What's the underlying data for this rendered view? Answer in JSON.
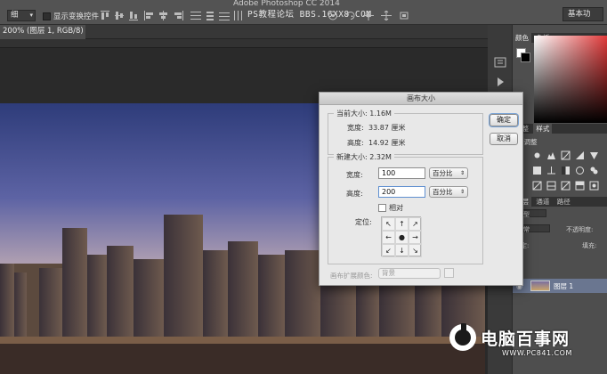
{
  "app": {
    "title": "Adobe Photoshop CC 2014",
    "watermark_text": "PS教程论坛 BBS.16XX8.COM"
  },
  "options_bar": {
    "style_value": "细",
    "show_transform_label": "显示变换控件",
    "workspace_label": "基本功"
  },
  "document": {
    "tab_label": "200% (图层 1, RGB/8) *"
  },
  "panels": {
    "color_tab": "颜色",
    "swatches_tab": "色板",
    "adjust_tab": "样式",
    "adjust_label": "调整",
    "add_adjust_label": "加调整",
    "layers_tabs": [
      "图层",
      "通道",
      "路径"
    ],
    "layer_kind": "类型",
    "blend_mode": "正常",
    "opacity_label": "不透明度:",
    "lock_label": "锁定:",
    "fill_label": "填充:",
    "layer_name": "图层 1"
  },
  "dialog": {
    "title": "画布大小",
    "current_size_label": "当前大小: 1.16M",
    "current_width_label": "宽度:",
    "current_width_value": "33.87 厘米",
    "current_height_label": "高度:",
    "current_height_value": "14.92 厘米",
    "new_size_label": "新建大小: 2.32M",
    "width_label": "宽度:",
    "width_value": "100",
    "width_unit": "百分比",
    "height_label": "高度:",
    "height_value": "200",
    "height_unit": "百分比",
    "relative_label": "相对",
    "anchor_label": "定位:",
    "anchor_arrows": [
      "↖",
      "↑",
      "↗",
      "←",
      "●",
      "→",
      "↙",
      "↓",
      "↘"
    ],
    "extension_color_label": "画布扩展颜色:",
    "extension_color_value": "背景",
    "ok_label": "确定",
    "cancel_label": "取消"
  },
  "logo": {
    "name": "电脑百事网",
    "url": "WWW.PC841.COM"
  },
  "colors": {
    "accent": "#79a3d6",
    "layer_selected": "#6a7690"
  }
}
